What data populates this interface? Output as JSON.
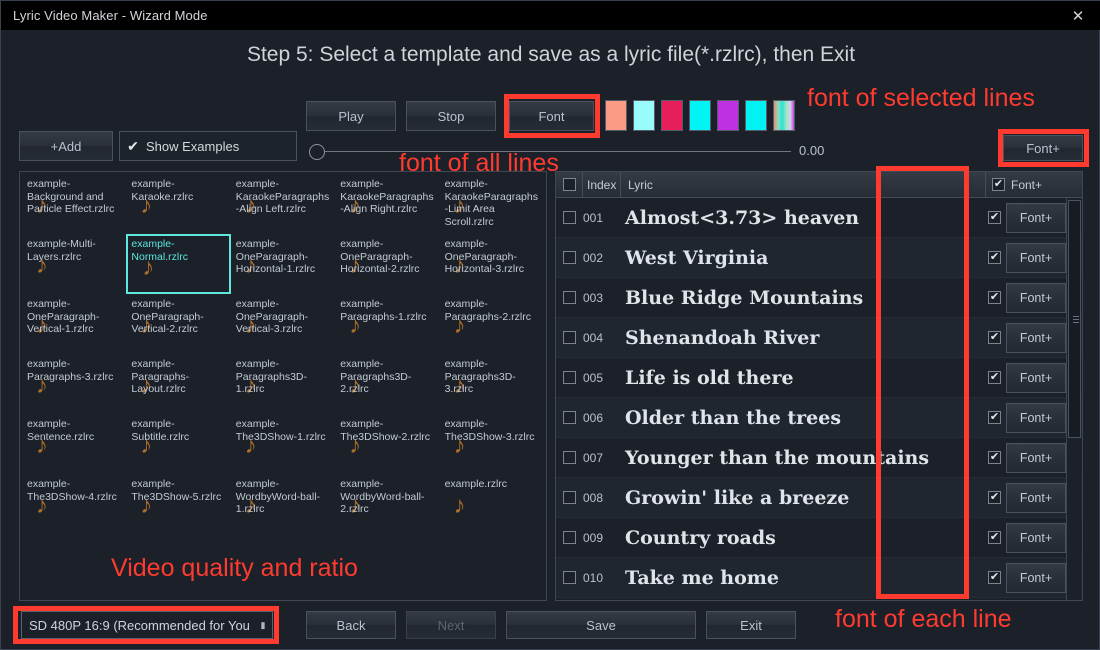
{
  "window": {
    "title": "Lyric Video Maker - Wizard Mode",
    "close_icon": "close-icon"
  },
  "step_title": "Step 5: Select a template and save as a lyric file(*.rzlrc), then Exit",
  "toolbar": {
    "play_label": "Play",
    "stop_label": "Stop",
    "font_label": "Font",
    "add_label": "+Add",
    "show_examples_label": "Show Examples",
    "show_examples_checked": true,
    "slider_value": "0.00",
    "font_plus_label": "Font+",
    "swatches": [
      "#fb9a85",
      "#99fbfb",
      "#e61f5c",
      "#00f4f4",
      "#bf31e0",
      "#00f2f2",
      "gradient"
    ]
  },
  "files": {
    "selected": "example-Normal.rzlrc",
    "items": [
      "example-Background and Particle Effect.rzlrc",
      "example-Karaoke.rzlrc",
      "example-KaraokeParagraphs-Align Left.rzlrc",
      "example-KaraokeParagraphs-Align Right.rzlrc",
      "example-KaraokeParagraphs-Limit Area Scroll.rzlrc",
      "example-Multi-Layers.rzlrc",
      "example-Normal.rzlrc",
      "example-OneParagraph-Horizontal-1.rzlrc",
      "example-OneParagraph-Horizontal-2.rzlrc",
      "example-OneParagraph-Horizontal-3.rzlrc",
      "example-OneParagraph-Vertical-1.rzlrc",
      "example-OneParagraph-Vertical-2.rzlrc",
      "example-OneParagraph-Vertical-3.rzlrc",
      "example-Paragraphs-1.rzlrc",
      "example-Paragraphs-2.rzlrc",
      "example-Paragraphs-3.rzlrc",
      "example-Paragraphs-Layout.rzlrc",
      "example-Paragraphs3D-1.rzlrc",
      "example-Paragraphs3D-2.rzlrc",
      "example-Paragraphs3D-3.rzlrc",
      "example-Sentence.rzlrc",
      "example-Subtitle.rzlrc",
      "example-The3DShow-1.rzlrc",
      "example-The3DShow-2.rzlrc",
      "example-The3DShow-3.rzlrc",
      "example-The3DShow-4.rzlrc",
      "example-The3DShow-5.rzlrc",
      "example-WordbyWord-ball-1.rzlrc",
      "example-WordbyWord-ball-2.rzlrc",
      "example.rzlrc"
    ]
  },
  "lyrics": {
    "headers": {
      "index": "Index",
      "lyric": "Lyric",
      "font": "Font+"
    },
    "header_checked": true,
    "rows": [
      {
        "index": "001",
        "text": "Almost<3.73> heaven",
        "checked": false,
        "font_label": "Font+",
        "font_checked": true
      },
      {
        "index": "002",
        "text": "West Virginia",
        "checked": false,
        "font_label": "Font+",
        "font_checked": true
      },
      {
        "index": "003",
        "text": "Blue Ridge Mountains",
        "checked": false,
        "font_label": "Font+",
        "font_checked": true
      },
      {
        "index": "004",
        "text": "Shenandoah River",
        "checked": false,
        "font_label": "Font+",
        "font_checked": true
      },
      {
        "index": "005",
        "text": "Life is old there",
        "checked": false,
        "font_label": "Font+",
        "font_checked": true
      },
      {
        "index": "006",
        "text": "Older than the trees",
        "checked": false,
        "font_label": "Font+",
        "font_checked": true
      },
      {
        "index": "007",
        "text": "Younger than the mountains",
        "checked": false,
        "font_label": "Font+",
        "font_checked": true
      },
      {
        "index": "008",
        "text": "Growin' like a breeze",
        "checked": false,
        "font_label": "Font+",
        "font_checked": true
      },
      {
        "index": "009",
        "text": "Country roads",
        "checked": false,
        "font_label": "Font+",
        "font_checked": true
      },
      {
        "index": "010",
        "text": "Take me home",
        "checked": false,
        "font_label": "Font+",
        "font_checked": true
      }
    ]
  },
  "bottom": {
    "quality_value": "SD 480P 16:9 (Recommended for You",
    "back_label": "Back",
    "next_label": "Next",
    "save_label": "Save",
    "exit_label": "Exit"
  },
  "annotations": {
    "color": "#ff3b30",
    "font_of_selected_lines": "font of selected lines",
    "font_of_all_lines": "font of all lines",
    "video_quality_and_ratio": "Video quality and ratio",
    "font_of_each_line": "font of each line"
  }
}
